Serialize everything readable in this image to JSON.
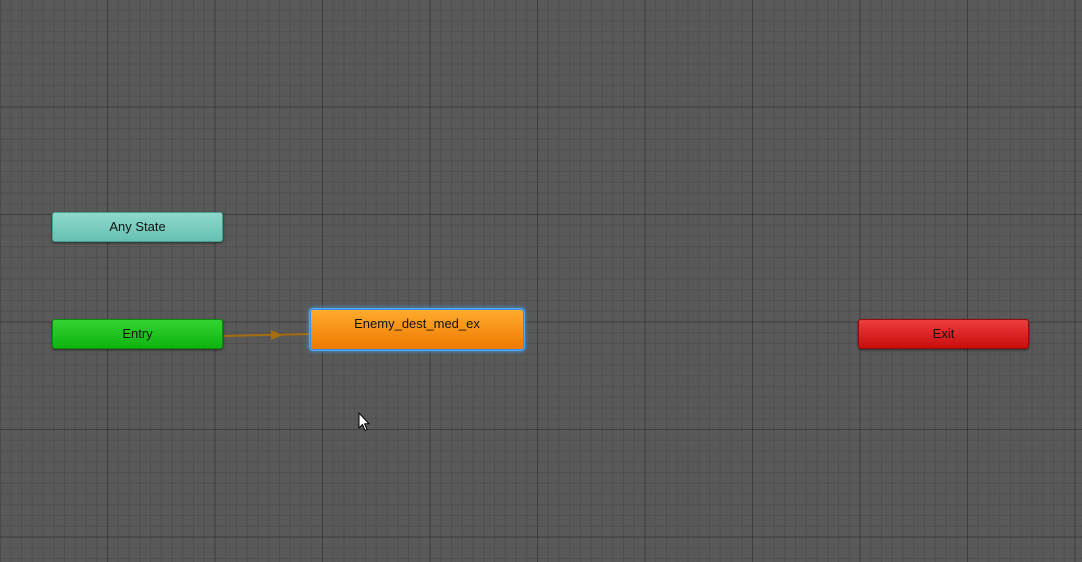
{
  "graph": {
    "nodes": {
      "any_state": {
        "label": "Any State",
        "color": "#66c1b3"
      },
      "entry": {
        "label": "Entry",
        "color": "#0fb30f"
      },
      "state": {
        "label": "Enemy_dest_med_ex",
        "color": "#ee7a00",
        "selected": true,
        "highlight_color": "#4aa8ff"
      },
      "exit": {
        "label": "Exit",
        "color": "#c90d0d"
      }
    },
    "transitions": [
      {
        "from": "Entry",
        "to": "Enemy_dest_med_ex",
        "color": "#a66d0f"
      }
    ],
    "background_color": "#595959"
  }
}
